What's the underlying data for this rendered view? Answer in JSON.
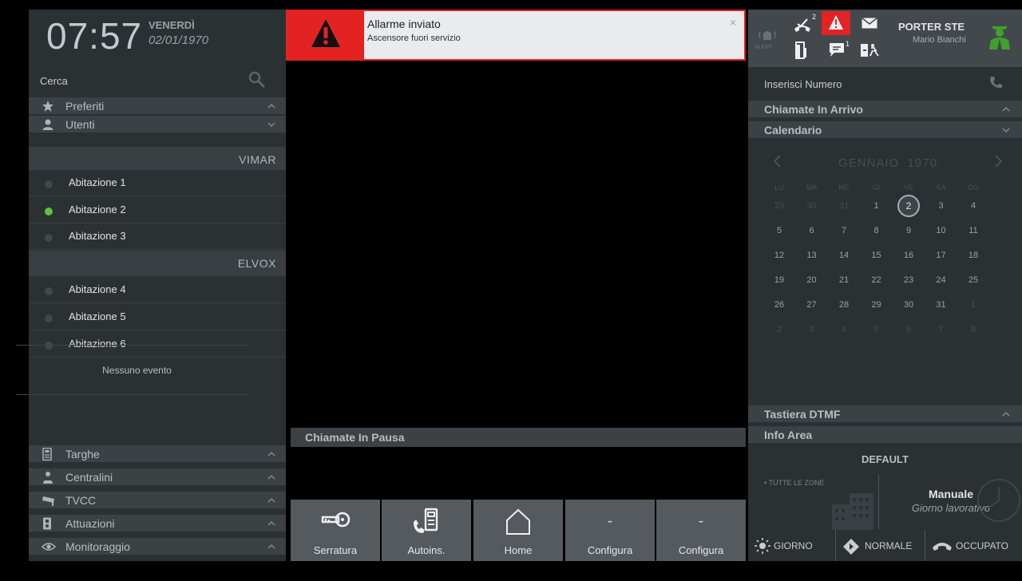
{
  "clock": {
    "time": "07:57",
    "day": "VENERDÌ",
    "date": "02/01/1970"
  },
  "left": {
    "search_label": "Cerca",
    "favorites": "Preferiti",
    "users": "Utenti",
    "groups": [
      {
        "name": "VIMAR",
        "items": [
          {
            "label": "Abitazione 1",
            "online": false
          },
          {
            "label": "Abitazione 2",
            "online": true
          },
          {
            "label": "Abitazione 3",
            "online": false
          }
        ]
      },
      {
        "name": "ELVOX",
        "items": [
          {
            "label": "Abitazione 4",
            "online": false
          },
          {
            "label": "Abitazione 5",
            "online": false
          },
          {
            "label": "Abitazione 6",
            "online": false
          }
        ]
      }
    ],
    "bottom_sections": [
      "Targhe",
      "Centralini",
      "TVCC",
      "Attuazioni",
      "Monitoraggio"
    ]
  },
  "alert": {
    "title": "Allarme inviato",
    "subtitle": "Ascensore fuori servizio",
    "close": "×",
    "accent": "#e32323"
  },
  "center": {
    "paused_calls": "Chiamate In Pausa",
    "buttons": [
      {
        "label": "Serratura",
        "icon": "key-icon"
      },
      {
        "label": "Autoins.",
        "icon": "intercom-call-icon"
      },
      {
        "label": "Home",
        "icon": "home-icon"
      },
      {
        "label": "Configura",
        "icon": "dash",
        "dash": "-"
      },
      {
        "label": "Configura",
        "icon": "dash",
        "dash": "-"
      }
    ]
  },
  "right": {
    "topbar": {
      "alert_label": "ALERT",
      "missed_calls_badge": "2",
      "messages_badge": "1",
      "porter_title": "PORTER STE",
      "porter_name": "Mario Bianchi"
    },
    "number_placeholder": "Inserisci Numero",
    "incoming_calls": "Chiamate In Arrivo",
    "calendar": {
      "label": "Calendario",
      "month": "GENNAIO",
      "year": "1970",
      "weekdays": [
        "LU",
        "MA",
        "ME",
        "GI",
        "VE",
        "SA",
        "DO"
      ],
      "weeks": [
        [
          "29",
          "30",
          "31",
          "1",
          "2",
          "3",
          "4"
        ],
        [
          "5",
          "6",
          "7",
          "8",
          "9",
          "10",
          "11"
        ],
        [
          "12",
          "13",
          "14",
          "15",
          "16",
          "17",
          "18"
        ],
        [
          "19",
          "20",
          "21",
          "22",
          "23",
          "24",
          "25"
        ],
        [
          "26",
          "27",
          "28",
          "29",
          "30",
          "31",
          "1"
        ],
        [
          "2",
          "3",
          "4",
          "5",
          "6",
          "7",
          "8"
        ]
      ],
      "selected": "2",
      "no_event": "Nessuno evento"
    },
    "dtmf": "Tastiera DTMF",
    "info": {
      "label": "Info Area",
      "profile": "DEFAULT",
      "zones": "• TUTTE LE ZONE",
      "mode": "Manuale",
      "day_type": "Giorno lavorativo"
    },
    "status": [
      {
        "label": "GIORNO",
        "icon": "sun-icon"
      },
      {
        "label": "NORMALE",
        "icon": "diamond-arrow-icon"
      },
      {
        "label": "OCCUPATO",
        "icon": "handset-down-icon"
      }
    ]
  },
  "colors": {
    "online": "#5ec43f",
    "porter_green": "#3fa12a",
    "alert_red": "#e32323"
  }
}
